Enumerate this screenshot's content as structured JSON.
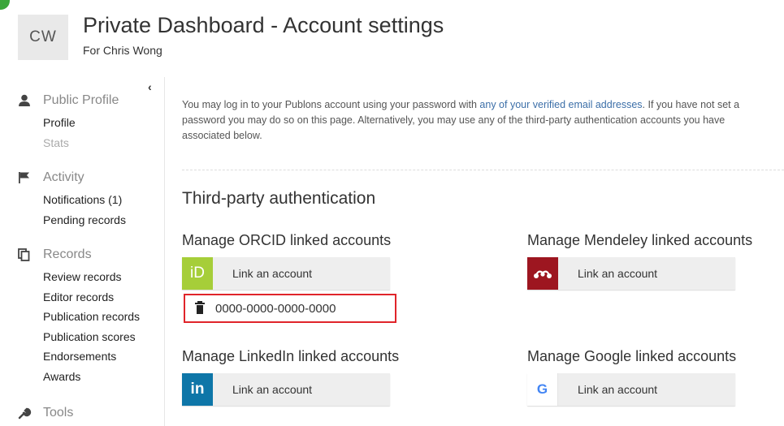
{
  "header": {
    "avatar_initials": "CW",
    "title": "Private Dashboard - Account settings",
    "subtitle": "For Chris Wong"
  },
  "sidebar": {
    "collapse_glyph": "‹",
    "sections": [
      {
        "icon": "user-icon",
        "heading": "Public Profile",
        "items": [
          "Profile",
          "Stats"
        ]
      },
      {
        "icon": "flag-icon",
        "heading": "Activity",
        "items": [
          "Notifications (1)",
          "Pending records"
        ]
      },
      {
        "icon": "copy-icon",
        "heading": "Records",
        "items": [
          "Review records",
          "Editor records",
          "Publication records",
          "Publication scores",
          "Endorsements",
          "Awards"
        ]
      },
      {
        "icon": "wrench-icon",
        "heading": "Tools",
        "items": []
      }
    ]
  },
  "main": {
    "intro_part1": "You may log in to your Publons account using your password with ",
    "intro_link": "any of your verified email addresses",
    "intro_part2": ". If you have not set a password you may do so on this page. Alternatively, you may use any of the third-party authentication accounts you have associated below.",
    "section_title": "Third-party authentication",
    "orcid": {
      "title": "Manage ORCID linked accounts",
      "button_label": "Link an account",
      "logo_text": "iD",
      "linked_id": "0000-0000-0000-0000"
    },
    "mendeley": {
      "title": "Manage Mendeley linked accounts",
      "button_label": "Link an account"
    },
    "linkedin": {
      "title": "Manage LinkedIn linked accounts",
      "button_label": "Link an account",
      "logo_text": "in"
    },
    "google": {
      "title": "Manage Google linked accounts",
      "button_label": "Link an account",
      "logo_text": "G"
    }
  },
  "colors": {
    "orcid": "#a6ce39",
    "mendeley": "#9d1620",
    "linkedin": "#0e76a8",
    "google": "#4285f4",
    "link": "#3c6fa8",
    "highlight_border": "#e0242a"
  }
}
